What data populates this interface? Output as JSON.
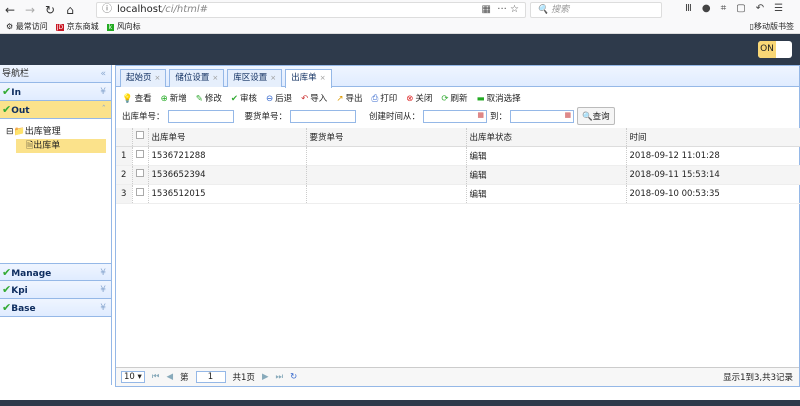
{
  "browser": {
    "url_host": "localhost",
    "url_path": "/ci/html#",
    "search_placeholder": "搜索",
    "bookmarks": [
      "最常访问",
      "京东商城",
      "风向标"
    ],
    "mobile_bookmarks": "移动版书签"
  },
  "header": {
    "toggle": "ON"
  },
  "sidebar": {
    "title": "导航栏",
    "panels": [
      "In",
      "Out",
      "Manage",
      "Kpi",
      "Base"
    ],
    "tree": {
      "folder": "出库管理",
      "leaf": "出库单"
    }
  },
  "tabs": [
    "起始页",
    "储位设置",
    "库区设置",
    "出库单"
  ],
  "toolbar": [
    "查看",
    "新增",
    "修改",
    "审核",
    "后退",
    "导入",
    "导出",
    "打印",
    "关闭",
    "刷新",
    "取消选择"
  ],
  "filter": {
    "order_no": "出库单号：",
    "req_no": "要货单号：",
    "created_from": "创建时间从：",
    "to": "到：",
    "query": "查询"
  },
  "table": {
    "columns": [
      "出库单号",
      "要货单号",
      "出库单状态",
      "时间"
    ],
    "rows": [
      {
        "n": "1",
        "no": "1536721288",
        "req": "",
        "status": "编辑",
        "time": "2018-09-12 11:01:28"
      },
      {
        "n": "2",
        "no": "1536652394",
        "req": "",
        "status": "编辑",
        "time": "2018-09-11 15:53:14"
      },
      {
        "n": "3",
        "no": "1536512015",
        "req": "",
        "status": "编辑",
        "time": "2018-09-10 00:53:35"
      }
    ]
  },
  "pager": {
    "page_size": "10",
    "page_label": "第",
    "page": "1",
    "total_pages": "共1页",
    "info": "显示1到3,共3记录"
  }
}
